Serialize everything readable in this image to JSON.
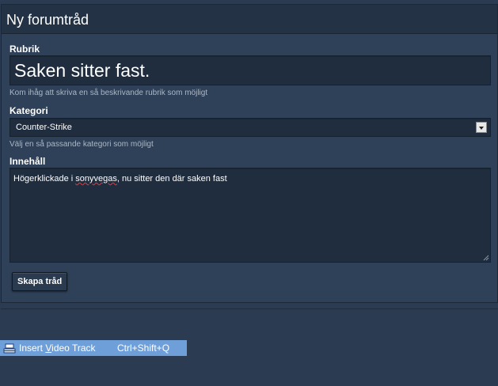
{
  "form": {
    "title": "Ny forumtråd",
    "subject_label": "Rubrik",
    "subject_value": "Saken sitter fast.",
    "subject_hint": "Kom ihåg att skriva en så beskrivande rubrik som möjligt",
    "category_label": "Kategori",
    "category_selected": "Counter-Strike",
    "category_hint": "Välj en så passande kategori som möjligt",
    "content_label": "Innehåll",
    "content_text_before": "Högerklickade i ",
    "content_text_misspelled": "sonyvegas",
    "content_text_after": ", nu sitter den där saken fast",
    "submit_label": "Skapa tråd"
  },
  "context_menu": {
    "item_label_prefix": "Insert ",
    "item_label_accel": "V",
    "item_label_rest": "ideo Track",
    "item_shortcut": "Ctrl+Shift+Q",
    "item_icon": "video-track-icon"
  },
  "colors": {
    "background": "#2b3c52",
    "panel": "#2f4158",
    "header": "#233244",
    "input": "#1f2d3f",
    "menu_highlight": "#6f9fd8"
  }
}
